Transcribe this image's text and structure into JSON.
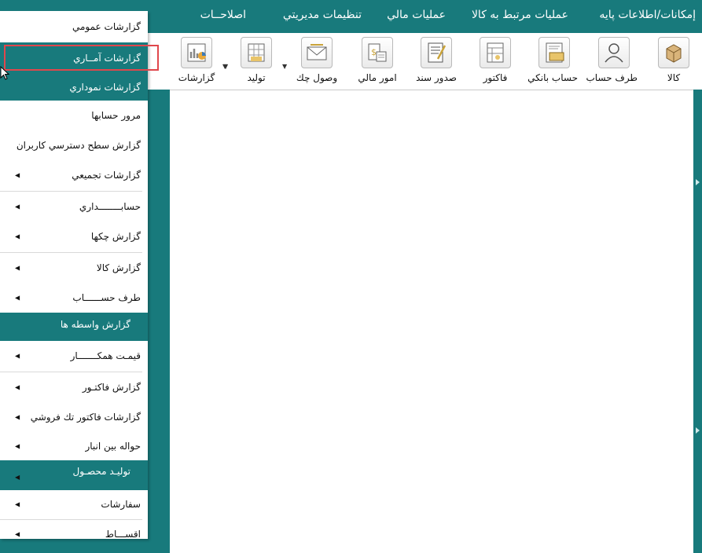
{
  "menubar": {
    "items": [
      {
        "label": "إمكانات/اطلاعات پايه"
      },
      {
        "label": "عمليات مرتبط به كالا"
      },
      {
        "label": "عمليات مالي"
      },
      {
        "label": "تنظيمات مديريتي"
      },
      {
        "label": "اصلاحــات"
      }
    ]
  },
  "toolbar": {
    "buttons": [
      {
        "label": "كالا",
        "icon": "box-icon"
      },
      {
        "label": "طرف حساب",
        "icon": "person-icon"
      },
      {
        "label": "حساب بانكي",
        "icon": "bank-card-icon"
      },
      {
        "label": "فاكتور",
        "icon": "invoice-icon"
      },
      {
        "label": "صدور سند",
        "icon": "document-pen-icon"
      },
      {
        "label": "امور مالي",
        "icon": "money-icon"
      },
      {
        "label": "وصول چك",
        "icon": "envelope-icon"
      },
      {
        "label": "توليد",
        "icon": "production-icon"
      },
      {
        "label": "گزارشات",
        "icon": "report-chart-icon"
      }
    ]
  },
  "dropdown": {
    "items": [
      {
        "label": "گزارشات عمومي",
        "submenu": false,
        "teal": false
      },
      {
        "label": "گزارشات آمــاري",
        "submenu": false,
        "teal": true
      },
      {
        "label": "گزارشات نموداري",
        "submenu": false,
        "teal": true
      },
      {
        "label": "مرور حسابها",
        "submenu": false,
        "teal": false
      },
      {
        "label": "گزارش سطح دسترسي كاربران",
        "submenu": false,
        "teal": false
      },
      {
        "label": "گزارشات تجميعي",
        "submenu": true,
        "teal": false
      },
      {
        "label": "حسابــــــــداري",
        "submenu": true,
        "teal": false
      },
      {
        "label": "گزارش چكها",
        "submenu": true,
        "teal": false
      },
      {
        "label": "گزارش كالا",
        "submenu": true,
        "teal": false
      },
      {
        "label": "طرف حســــــاب",
        "submenu": true,
        "teal": false
      },
      {
        "label": "گزارش واسطه ها",
        "submenu": false,
        "teal": true
      },
      {
        "label": "قيمـت همكـــــــار",
        "submenu": true,
        "teal": false
      },
      {
        "label": "گزارش فاكتـور",
        "submenu": true,
        "teal": false
      },
      {
        "label": "گزارشات فاكتور تك فروشي",
        "submenu": true,
        "teal": false
      },
      {
        "label": "حواله بين انبار",
        "submenu": true,
        "teal": false
      },
      {
        "label": "توليـد محصـول",
        "submenu": true,
        "teal": true
      },
      {
        "label": "سفارشات",
        "submenu": true,
        "teal": false
      },
      {
        "label": "اقســـاط",
        "submenu": true,
        "teal": false
      }
    ]
  },
  "colors": {
    "teal": "#187a7c",
    "highlight_border": "#e0474c"
  }
}
